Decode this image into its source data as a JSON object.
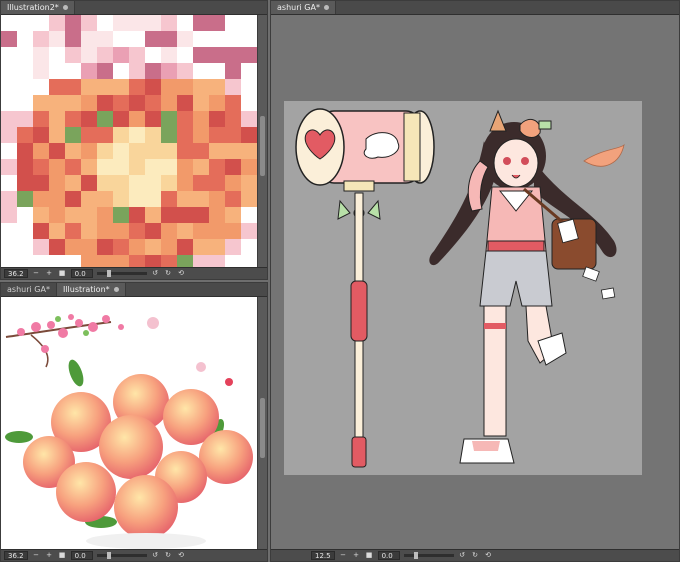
{
  "panes": {
    "top_left": {
      "tabs": [
        {
          "label": "Illustration2*",
          "active": true
        }
      ],
      "zoom": "36.2",
      "angle": "0.0"
    },
    "bottom_left": {
      "tabs": [
        {
          "label": "ashuri GA*",
          "active": false
        },
        {
          "label": "Illustration*",
          "active": true
        }
      ],
      "zoom": "36.2",
      "angle": "0.0"
    },
    "main": {
      "tabs": [
        {
          "label": "ashuri GA*",
          "active": true
        }
      ],
      "zoom": "12.5",
      "angle": "0.0"
    }
  },
  "colors": {
    "peach": "#f2a27d",
    "pink": "#f4b7c0",
    "hammer_red": "#e25b63",
    "canvas_gray": "#a3a3a3"
  }
}
